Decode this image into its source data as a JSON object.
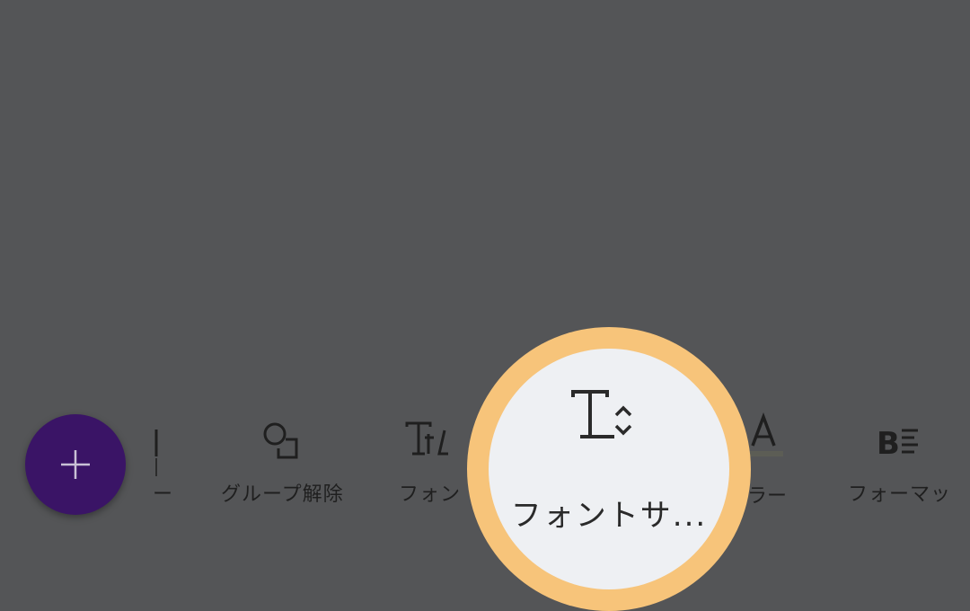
{
  "colors": {
    "background": "#545557",
    "fab": "#3a1466",
    "highlight_ring": "#f7c47a",
    "highlight_fill": "#eef0f3",
    "text": "#1f1f1f"
  },
  "fab": {
    "icon": "plus-icon"
  },
  "toolbar": {
    "items": [
      {
        "label": "ー",
        "icon": "cut-off-icon"
      },
      {
        "label": "グループ解除",
        "icon": "ungroup-icon"
      },
      {
        "label": "フォン",
        "icon": "font-icon"
      },
      {
        "label": "フォントサ...",
        "icon": "font-size-icon"
      },
      {
        "label": "ラー",
        "icon": "text-color-icon"
      },
      {
        "label": "フォーマッ",
        "icon": "format-icon"
      }
    ]
  }
}
